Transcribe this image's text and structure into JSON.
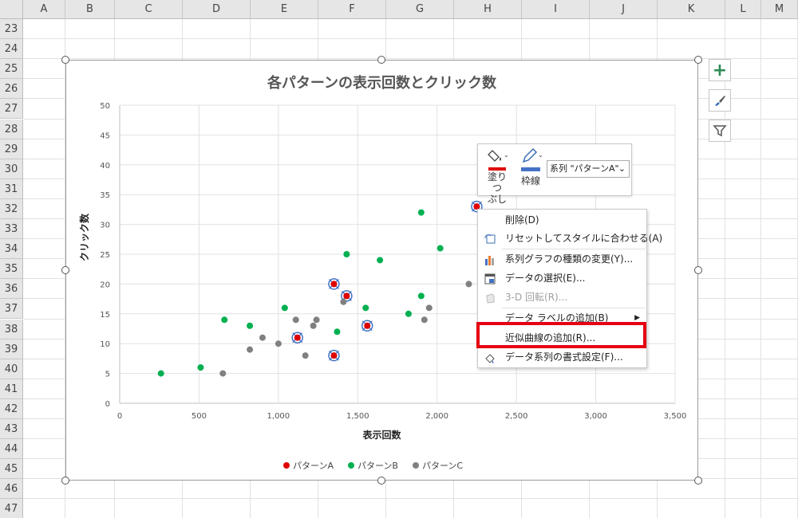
{
  "spreadsheet": {
    "columns": [
      "A",
      "B",
      "C",
      "D",
      "E",
      "F",
      "G",
      "H",
      "I",
      "J",
      "K",
      "L",
      "M"
    ],
    "rows": [
      "23",
      "24",
      "25",
      "26",
      "27",
      "28",
      "29",
      "30",
      "31",
      "32",
      "33",
      "34",
      "35",
      "36",
      "37",
      "38",
      "39",
      "40",
      "41",
      "42",
      "43",
      "44",
      "45",
      "46",
      "47"
    ]
  },
  "chart_data": {
    "type": "scatter",
    "title": "各パターンの表示回数とクリック数",
    "xlabel": "表示回数",
    "ylabel": "クリック数",
    "xlim": [
      0,
      3500
    ],
    "ylim": [
      0,
      50
    ],
    "x_ticks": [
      "0",
      "500",
      "1,000",
      "1,500",
      "2,000",
      "2,500",
      "3,000",
      "3,500"
    ],
    "y_ticks": [
      "0",
      "5",
      "10",
      "15",
      "20",
      "25",
      "30",
      "35",
      "40",
      "45",
      "50"
    ],
    "grid": true,
    "legend_position": "bottom",
    "series": [
      {
        "name": "パターンA",
        "color": "#e00000",
        "points": [
          [
            1120,
            11
          ],
          [
            1350,
            20
          ],
          [
            1350,
            8
          ],
          [
            1430,
            18
          ],
          [
            1560,
            13
          ],
          [
            2250,
            33
          ]
        ]
      },
      {
        "name": "パターンB",
        "color": "#00b050",
        "points": [
          [
            260,
            5
          ],
          [
            510,
            6
          ],
          [
            660,
            14
          ],
          [
            820,
            13
          ],
          [
            1040,
            16
          ],
          [
            1370,
            12
          ],
          [
            1430,
            25
          ],
          [
            1550,
            16
          ],
          [
            1640,
            24
          ],
          [
            1820,
            15
          ],
          [
            1900,
            18
          ],
          [
            1900,
            32
          ],
          [
            2020,
            26
          ]
        ]
      },
      {
        "name": "パターンC",
        "color": "#808080",
        "points": [
          [
            650,
            5
          ],
          [
            820,
            9
          ],
          [
            900,
            11
          ],
          [
            1000,
            10
          ],
          [
            1110,
            14
          ],
          [
            1170,
            8
          ],
          [
            1220,
            13
          ],
          [
            1240,
            14
          ],
          [
            1410,
            17
          ],
          [
            1920,
            14
          ],
          [
            1950,
            16
          ],
          [
            2200,
            20
          ]
        ]
      }
    ]
  },
  "side_buttons": {
    "add": "+",
    "style": "brush-icon",
    "filter": "filter-icon"
  },
  "minibar": {
    "fill_label_1": "塗りつ",
    "fill_label_2": "ぶし",
    "outline_label": "枠線",
    "series_select": "系列 \"パターンA\""
  },
  "context_menu": {
    "items": [
      {
        "label": "削除(D)",
        "icon": "delete",
        "disabled": false
      },
      {
        "label": "リセットしてスタイルに合わせる(A)",
        "icon": "reset-style-icon",
        "disabled": false
      },
      {
        "label": "系列グラフの種類の変更(Y)...",
        "icon": "chart-type-icon",
        "disabled": false
      },
      {
        "label": "データの選択(E)...",
        "icon": "select-data-icon",
        "disabled": false
      },
      {
        "label": "3-D 回転(R)...",
        "icon": "rotate-3d-icon",
        "disabled": true
      },
      {
        "label": "データ ラベルの追加(B)",
        "icon": "",
        "disabled": false
      },
      {
        "label": "近似曲線の追加(R)...",
        "icon": "",
        "disabled": false
      },
      {
        "label": "データ系列の書式設定(F)...",
        "icon": "format-series-icon",
        "disabled": false
      }
    ]
  },
  "colors": {
    "highlight": "#e60012",
    "fill_swatch": "#e00000",
    "outline_swatch": "#4472c4"
  }
}
